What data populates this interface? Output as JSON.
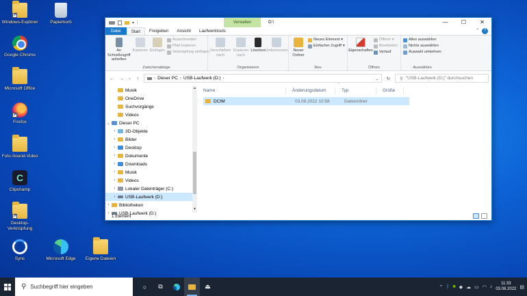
{
  "desktop": {
    "icons": [
      {
        "label": "Windows-Explorer",
        "icon": "explorer-icon"
      },
      {
        "label": "Papierkorb",
        "icon": "recycle-bin-icon"
      },
      {
        "label": "Google Chrome",
        "icon": "chrome-icon"
      },
      {
        "label": "Microsoft Office",
        "icon": "folder-icon"
      },
      {
        "label": "Firefox",
        "icon": "firefox-icon"
      },
      {
        "label": "Foto-Sound-Video",
        "icon": "folder-icon"
      },
      {
        "label": "Clipchamp",
        "icon": "clipchamp-icon"
      },
      {
        "label": "Desktop-Verknüpfung",
        "icon": "folder-shortcut-icon"
      },
      {
        "label": "Sync",
        "icon": "sync-icon"
      },
      {
        "label": "Microsoft Edge",
        "icon": "edge-icon"
      },
      {
        "label": "Eigene Dateien",
        "icon": "folder-icon"
      }
    ]
  },
  "window": {
    "title": "D:\\",
    "context_tab": "Verwalten",
    "controls": {
      "minimize": "—",
      "maximize": "☐",
      "close": "✕"
    },
    "ribbon_tabs": [
      "Datei",
      "Start",
      "Freigeben",
      "Ansicht",
      "Laufwerktools"
    ],
    "ribbon": {
      "clipboard": {
        "group_label": "Zwischenablage",
        "pin": "An Schnellzugriff anheften",
        "copy": "Kopieren",
        "paste": "Einfügen",
        "cut": "Ausschneiden",
        "copy_path": "Pfad kopieren",
        "paste_shortcut": "Verknüpfung einfügen"
      },
      "organize": {
        "group_label": "Organisieren",
        "move_to": "Verschieben nach",
        "copy_to": "Kopieren nach",
        "delete": "Löschen",
        "rename": "Umbenennen"
      },
      "new": {
        "group_label": "Neu",
        "new_folder": "Neuer Ordner",
        "new_item": "Neues Element",
        "easy_access": "Einfacher Zugriff"
      },
      "open": {
        "group_label": "Öffnen",
        "properties": "Eigenschaften",
        "open": "Öffnen",
        "edit": "Bearbeiten",
        "history": "Verlauf"
      },
      "select": {
        "group_label": "Auswählen",
        "select_all": "Alles auswählen",
        "select_none": "Nichts auswählen",
        "invert": "Auswahl umkehren"
      }
    },
    "address": {
      "crumbs": [
        "Dieser PC",
        "USB-Laufwerk (D:)"
      ],
      "search_placeholder": "\"USB-Laufwerk (D:)\" durchsuchen"
    },
    "nav_items": [
      {
        "label": "Musik",
        "indent": 2
      },
      {
        "label": "OneDrive",
        "indent": 2
      },
      {
        "label": "Suchvorgänge",
        "indent": 2
      },
      {
        "label": "Videos",
        "indent": 2
      },
      {
        "label": "Dieser PC",
        "indent": 1
      },
      {
        "label": "3D-Objekte",
        "indent": 2
      },
      {
        "label": "Bilder",
        "indent": 2
      },
      {
        "label": "Desktop",
        "indent": 2
      },
      {
        "label": "Dokumente",
        "indent": 2
      },
      {
        "label": "Downloads",
        "indent": 2
      },
      {
        "label": "Musik",
        "indent": 2
      },
      {
        "label": "Videos",
        "indent": 2
      },
      {
        "label": "Lokaler Datenträger (C:)",
        "indent": 2
      },
      {
        "label": "USB-Laufwerk (D:)",
        "indent": 2
      },
      {
        "label": "Bibliotheken",
        "indent": 1
      },
      {
        "label": "USB-Laufwerk (D:)",
        "indent": 1
      }
    ],
    "columns": [
      "Name",
      "Änderungsdatum",
      "Typ",
      "Größe"
    ],
    "files": [
      {
        "name": "DCIM",
        "modified": "03.08.2022 10:58",
        "type": "Dateiordner",
        "size": ""
      }
    ],
    "status": "1 Element"
  },
  "taskbar": {
    "search_placeholder": "Suchbegriff hier eingeben",
    "time": "11:33",
    "date": "03.08.2022"
  },
  "colors": {
    "accent": "#1979ca",
    "selection": "#cce8ff",
    "context_tab": "#c5e3a5",
    "taskbar": "#1b2433"
  }
}
